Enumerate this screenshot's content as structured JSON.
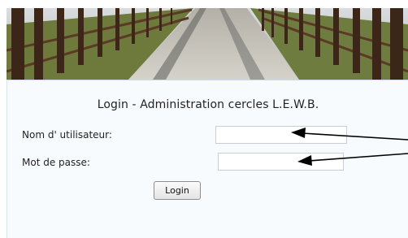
{
  "banner": {
    "image_name": "bridge-photo"
  },
  "login": {
    "title": "Login - Administration cercles L.E.W.B.",
    "username_label": "Nom d' utilisateur:",
    "username_value": "",
    "password_label": "Mot de passe:",
    "password_value": "",
    "button_label": "Login"
  },
  "colors": {
    "panel_background": "#f8fbfe",
    "annotation_arrow": "#000000"
  }
}
